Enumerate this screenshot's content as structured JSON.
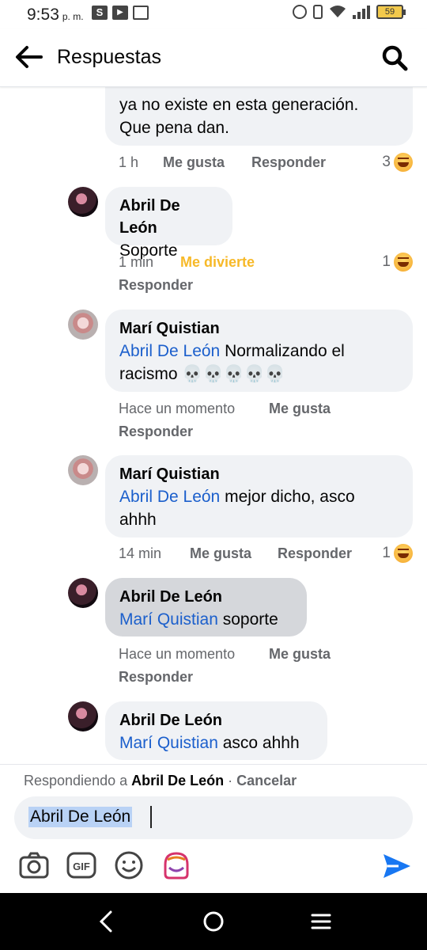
{
  "status_bar": {
    "time": "9:53",
    "ampm": "p. m.",
    "apps": [
      "S",
      "▶",
      "▭"
    ],
    "network": "4G",
    "battery": "59"
  },
  "header": {
    "title": "Respuestas"
  },
  "comments": [
    {
      "partial": true,
      "text_line1": "ya no existe en esta generación.",
      "text_line2": "Que pena dan.",
      "time": "1 h",
      "like": "Me gusta",
      "reply": "Responder",
      "reactions": "3"
    },
    {
      "author": "Abril De León",
      "text": "Soporte",
      "time": "1 min",
      "like": "Me divierte",
      "reply": "Responder",
      "reactions": "1"
    },
    {
      "author": "Marí Quistian",
      "mention": "Abril De León",
      "text_line1": " Normalizando el",
      "text_line2": "racismo 💀💀💀💀💀",
      "time": "Hace un momento",
      "like": "Me gusta",
      "reply": "Responder"
    },
    {
      "author": "Marí Quistian",
      "mention": "Abril De León",
      "text_line1": " mejor dicho, asco",
      "text_line2": "ahhh",
      "time": "14 min",
      "like": "Me gusta",
      "reply": "Responder",
      "reactions": "1"
    },
    {
      "author": "Abril De León",
      "mention": "Marí Quistian",
      "text": " soporte",
      "time": "Hace un momento",
      "like": "Me gusta",
      "reply": "Responder"
    },
    {
      "author": "Abril De León",
      "mention": "Marí Quistian",
      "text": " asco ahhh"
    }
  ],
  "reply_bar": {
    "replying_to_prefix": "Respondiendo a ",
    "replying_to_name": "Abril De León",
    "separator": " · ",
    "cancel": "Cancelar",
    "input_value": "Abril De León",
    "gif_label": "GIF"
  },
  "colors": {
    "mention": "#1b5fcc",
    "bubble": "#f0f2f5",
    "haha": "#f7b928",
    "send": "#1877f2"
  }
}
